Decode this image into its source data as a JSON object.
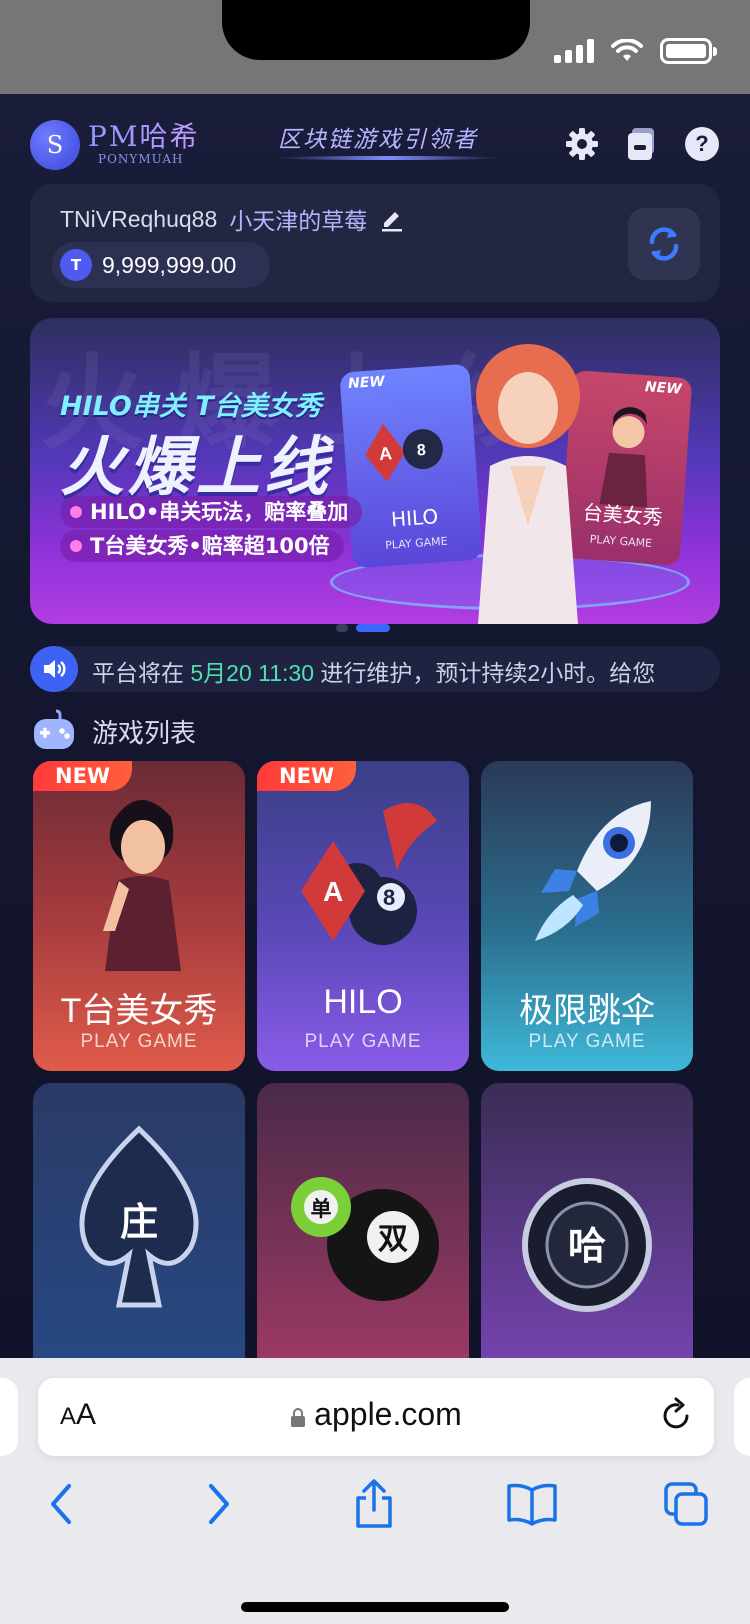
{
  "header": {
    "logo_glyph": "S",
    "logo_main": "PM哈希",
    "logo_sub": "PONYMUAH",
    "slogan": "区块链游戏引领者"
  },
  "account": {
    "username": "TNiVReqhuq88",
    "nickname": "小天津的草莓",
    "coin_glyph": "T",
    "balance": "9,999,999.00"
  },
  "banner": {
    "bg_text": "火爆上线",
    "subtitle": "HILO串关 T台美女秀",
    "title": "火爆上线",
    "line1": "HILO•串关玩法，赔率叠加",
    "line2": "T台美女秀•赔率超100倍",
    "card_hilo": {
      "tag": "NEW",
      "title": "HILO",
      "sub": "PLAY GAME"
    },
    "card_tai": {
      "tag": "NEW",
      "title": "台美女秀",
      "sub": "PLAY GAME"
    },
    "active_slide": 2,
    "slide_count": 2
  },
  "notice": {
    "prefix": "平台将在 ",
    "highlight": "5月20 11:30",
    "suffix": " 进行维护，预计持续2小时。给您"
  },
  "section": {
    "title": "游戏列表"
  },
  "games": [
    {
      "title": "T台美女秀",
      "sub": "PLAY GAME",
      "tag": "NEW",
      "icon": "showgirl-icon"
    },
    {
      "title": "HILO",
      "sub": "PLAY GAME",
      "tag": "NEW",
      "icon": "cards-icon"
    },
    {
      "title": "极限跳伞",
      "sub": "PLAY GAME",
      "tag": "",
      "icon": "rocket-icon"
    },
    {
      "title": "",
      "sub": "",
      "tag": "",
      "icon": "spade-icon",
      "glyph": "庄"
    },
    {
      "title": "",
      "sub": "",
      "tag": "",
      "icon": "ball-icon",
      "glyph_small": "单",
      "glyph": "双"
    },
    {
      "title": "",
      "sub": "",
      "tag": "",
      "icon": "chip-icon",
      "glyph": "哈"
    }
  ],
  "browser": {
    "aa_big": "A",
    "aa_small": "A",
    "url": "apple.com"
  },
  "colors": {
    "accent": "#3c66ff",
    "notice_highlight": "#4ee0b0",
    "new_tag": "#ff3b3b"
  }
}
